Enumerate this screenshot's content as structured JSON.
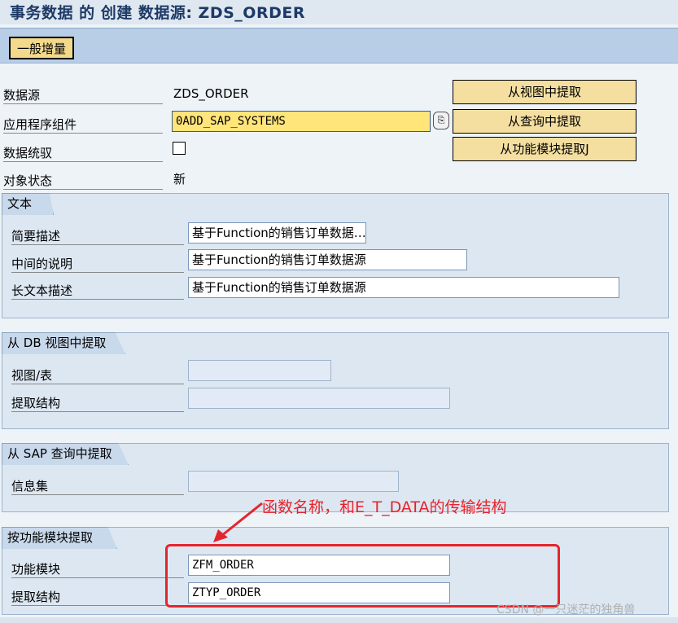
{
  "window": {
    "title": "事务数据 的 创建 数据源: ZDS_ORDER"
  },
  "toolbar": {
    "general_label": "一般增量"
  },
  "header_fields": {
    "datasource_label": "数据源",
    "datasource_value": "ZDS_ORDER",
    "app_component_label": "应用程序组件",
    "app_component_value": "0ADD_SAP_SYSTEMS",
    "data_protection_label": "数据统驭",
    "data_protection_checked": false,
    "object_status_label": "对象状态",
    "object_status_value": "新"
  },
  "extract_buttons": {
    "from_view": "从视图中提取",
    "from_query": "从查询中提取",
    "from_fm": "从功能模块提取J"
  },
  "text_group": {
    "title": "文本",
    "short_label": "简要描述",
    "short_value": "基于Function的销售订单数据…",
    "medium_label": "中间的说明",
    "medium_value": "基于Function的销售订单数据源",
    "long_label": "长文本描述",
    "long_value": "基于Function的销售订单数据源"
  },
  "db_group": {
    "title": "从 DB 视图中提取",
    "view_label": "视图/表",
    "view_value": "",
    "struct_label": "提取结构",
    "struct_value": ""
  },
  "sap_query_group": {
    "title": "从 SAP 查询中提取",
    "infoset_label": "信息集",
    "infoset_value": ""
  },
  "fm_group": {
    "title": "按功能模块提取",
    "fm_label": "功能模块",
    "fm_value": "ZFM_ORDER",
    "struct_label": "提取结构",
    "struct_value": "ZTYP_ORDER"
  },
  "annotation": {
    "text": "函数名称，和E_T_DATA的传输结构"
  },
  "watermark": {
    "text": "CSDN @一只迷茫的独角兽"
  },
  "colors": {
    "annotation_red": "#e5252d",
    "button_yellow": "#f4dfa0",
    "group_bg": "#dce7f2"
  }
}
